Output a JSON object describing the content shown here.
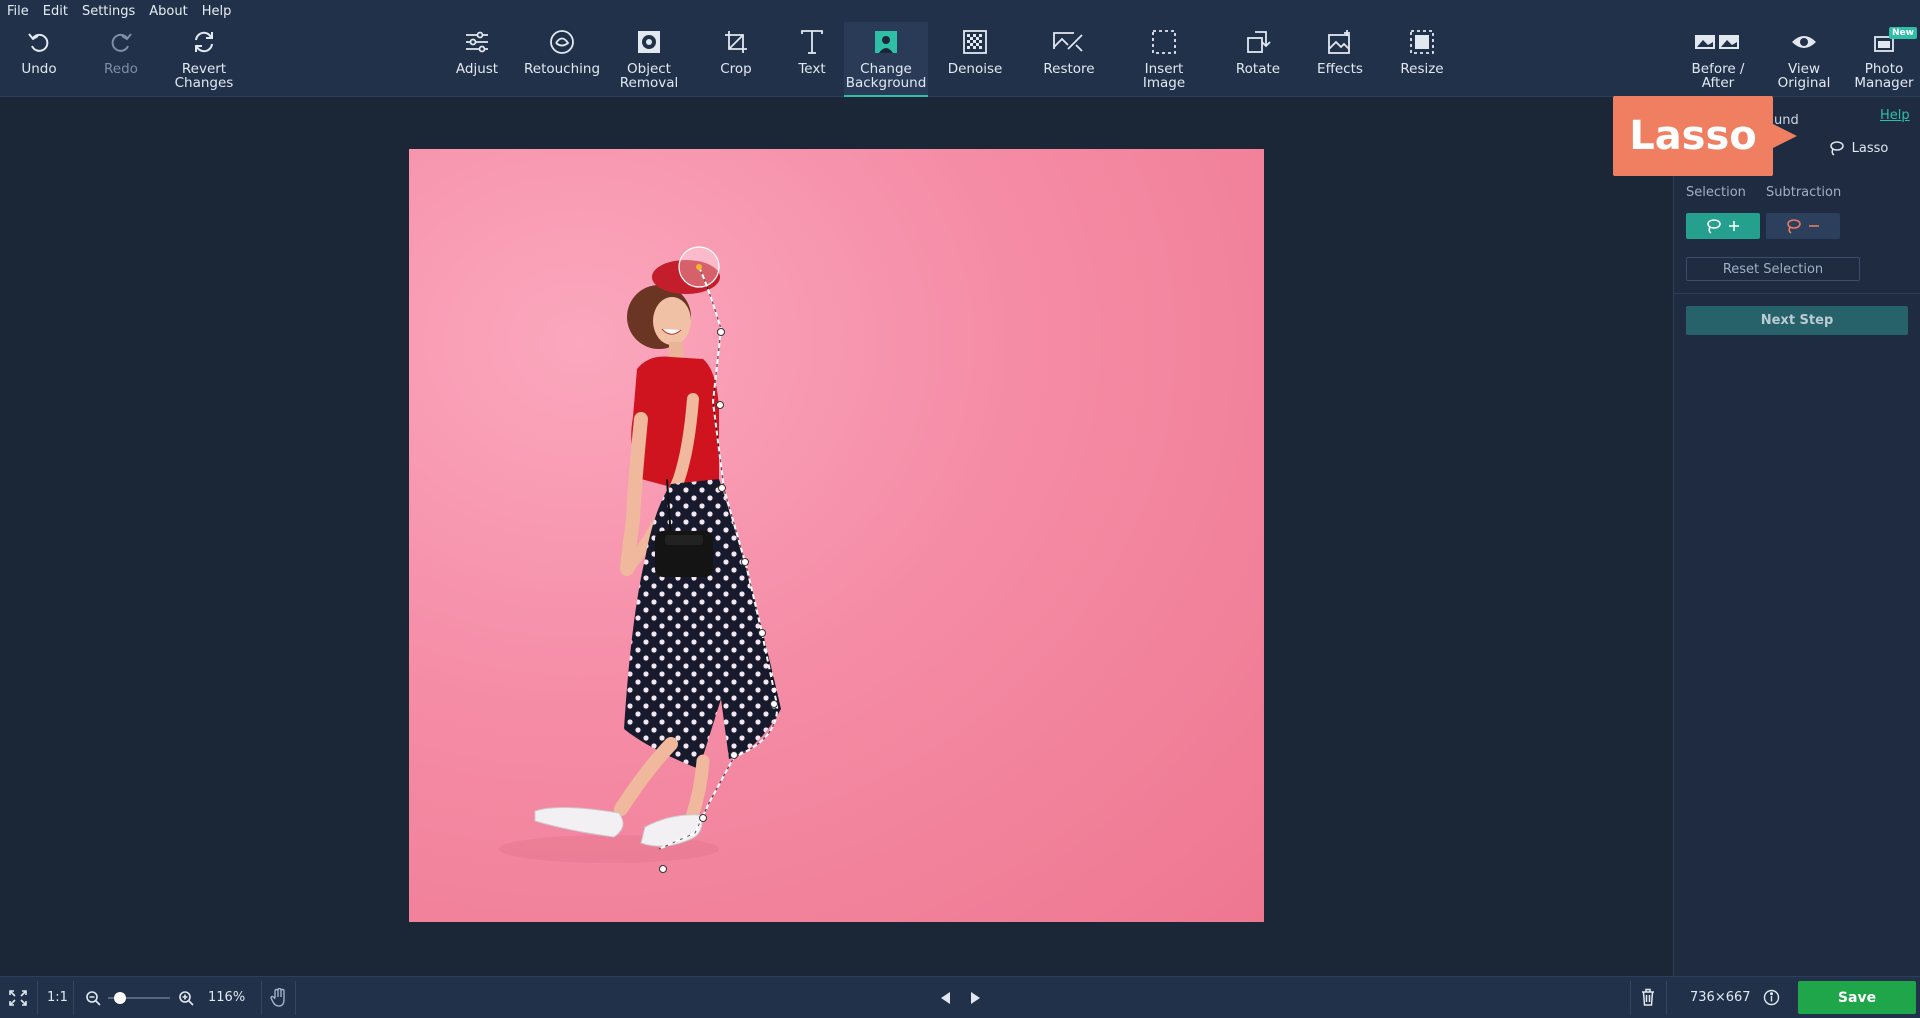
{
  "menu": [
    "File",
    "Edit",
    "Settings",
    "About",
    "Help"
  ],
  "toolbar": {
    "undo": "Undo",
    "redo": "Redo",
    "revert": "Revert\nChanges",
    "adjust": "Adjust",
    "retouching": "Retouching",
    "object_removal": "Object\nRemoval",
    "crop": "Crop",
    "text": "Text",
    "change_background": "Change\nBackground",
    "denoise": "Denoise",
    "restore": "Restore",
    "insert_image": "Insert\nImage",
    "rotate": "Rotate",
    "effects": "Effects",
    "resize": "Resize",
    "before_after": "Before /\nAfter",
    "view_original": "View\nOriginal",
    "photo_manager": "Photo\nManager",
    "new_badge": "New"
  },
  "panel": {
    "title_fragment": "und",
    "help": "Help",
    "lasso_tab": "Lasso",
    "selection": "Selection",
    "subtraction": "Subtraction",
    "reset_selection": "Reset Selection",
    "next_step": "Next Step"
  },
  "callout": {
    "text": "Lasso"
  },
  "status": {
    "one_to_one": "1:1",
    "zoom": "116%",
    "dimensions": "736×667",
    "save": "Save",
    "zoom_fraction": 0.1
  },
  "colors": {
    "accent": "#2fbfa7",
    "save_green": "#1fa64a",
    "callout": "#f07f62",
    "background": "#1b2637",
    "photo_pink": "#f58ca6"
  },
  "icons": [
    "undo-icon",
    "redo-icon",
    "revert-icon",
    "adjust-icon",
    "retouching-icon",
    "object-removal-icon",
    "crop-icon",
    "text-icon",
    "change-background-icon",
    "denoise-icon",
    "restore-icon",
    "insert-image-icon",
    "rotate-icon",
    "effects-icon",
    "resize-icon",
    "before-after-icon",
    "eye-icon",
    "photo-manager-icon"
  ]
}
